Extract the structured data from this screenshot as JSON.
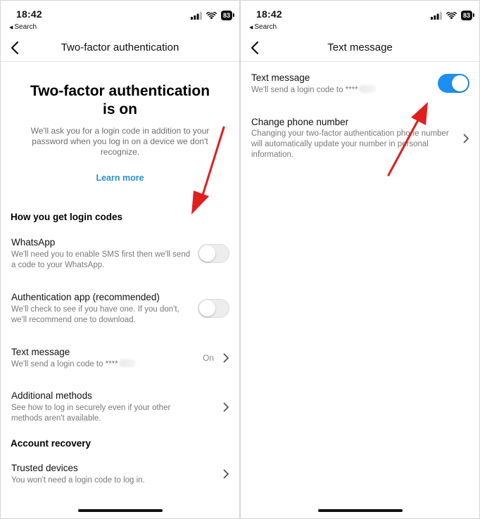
{
  "left": {
    "status": {
      "time": "18:42",
      "back_label": "Search",
      "battery": "83"
    },
    "nav": {
      "title": "Two-factor authentication"
    },
    "hero": {
      "title_line1": "Two-factor authentication",
      "title_line2": "is on",
      "description": "We'll ask you for a login code in addition to your password when you log in on a device we don't recognize.",
      "learn_more": "Learn more"
    },
    "section_login": "How you get login codes",
    "whatsapp": {
      "title": "WhatsApp",
      "subtitle": "We'll need you to enable SMS first then we'll send a code to your WhatsApp.",
      "enabled": false
    },
    "auth_app": {
      "title": "Authentication app (recommended)",
      "subtitle": "We'll check to see if you have one. If you don't, we'll recommend one to download.",
      "enabled": false
    },
    "text_message": {
      "title": "Text message",
      "subtitle": "We'll send a login code to ****",
      "status": "On"
    },
    "additional": {
      "title": "Additional methods",
      "subtitle": "See how to log in securely even if your other methods aren't available."
    },
    "section_recovery": "Account recovery",
    "trusted": {
      "title": "Trusted devices",
      "subtitle": "You won't need a login code to log in."
    }
  },
  "right": {
    "status": {
      "time": "18:42",
      "back_label": "Search",
      "battery": "83"
    },
    "nav": {
      "title": "Text message"
    },
    "text_message": {
      "title": "Text message",
      "subtitle": "We'll send a login code to ****",
      "enabled": true
    },
    "change_phone": {
      "title": "Change phone number",
      "subtitle": "Changing your two-factor authentication phone number will automatically update your number in personal information."
    }
  },
  "colors": {
    "accent_blue": "#2a90d4",
    "toggle_on": "#1d8ff0",
    "annotation_red": "#e01f1f"
  },
  "icons": {
    "back": "chevron-left-icon",
    "row": "chevron-right-icon",
    "signal": "cellular-signal-icon",
    "wifi": "wifi-icon",
    "battery": "battery-icon",
    "annotation": "red-arrow-icon"
  }
}
